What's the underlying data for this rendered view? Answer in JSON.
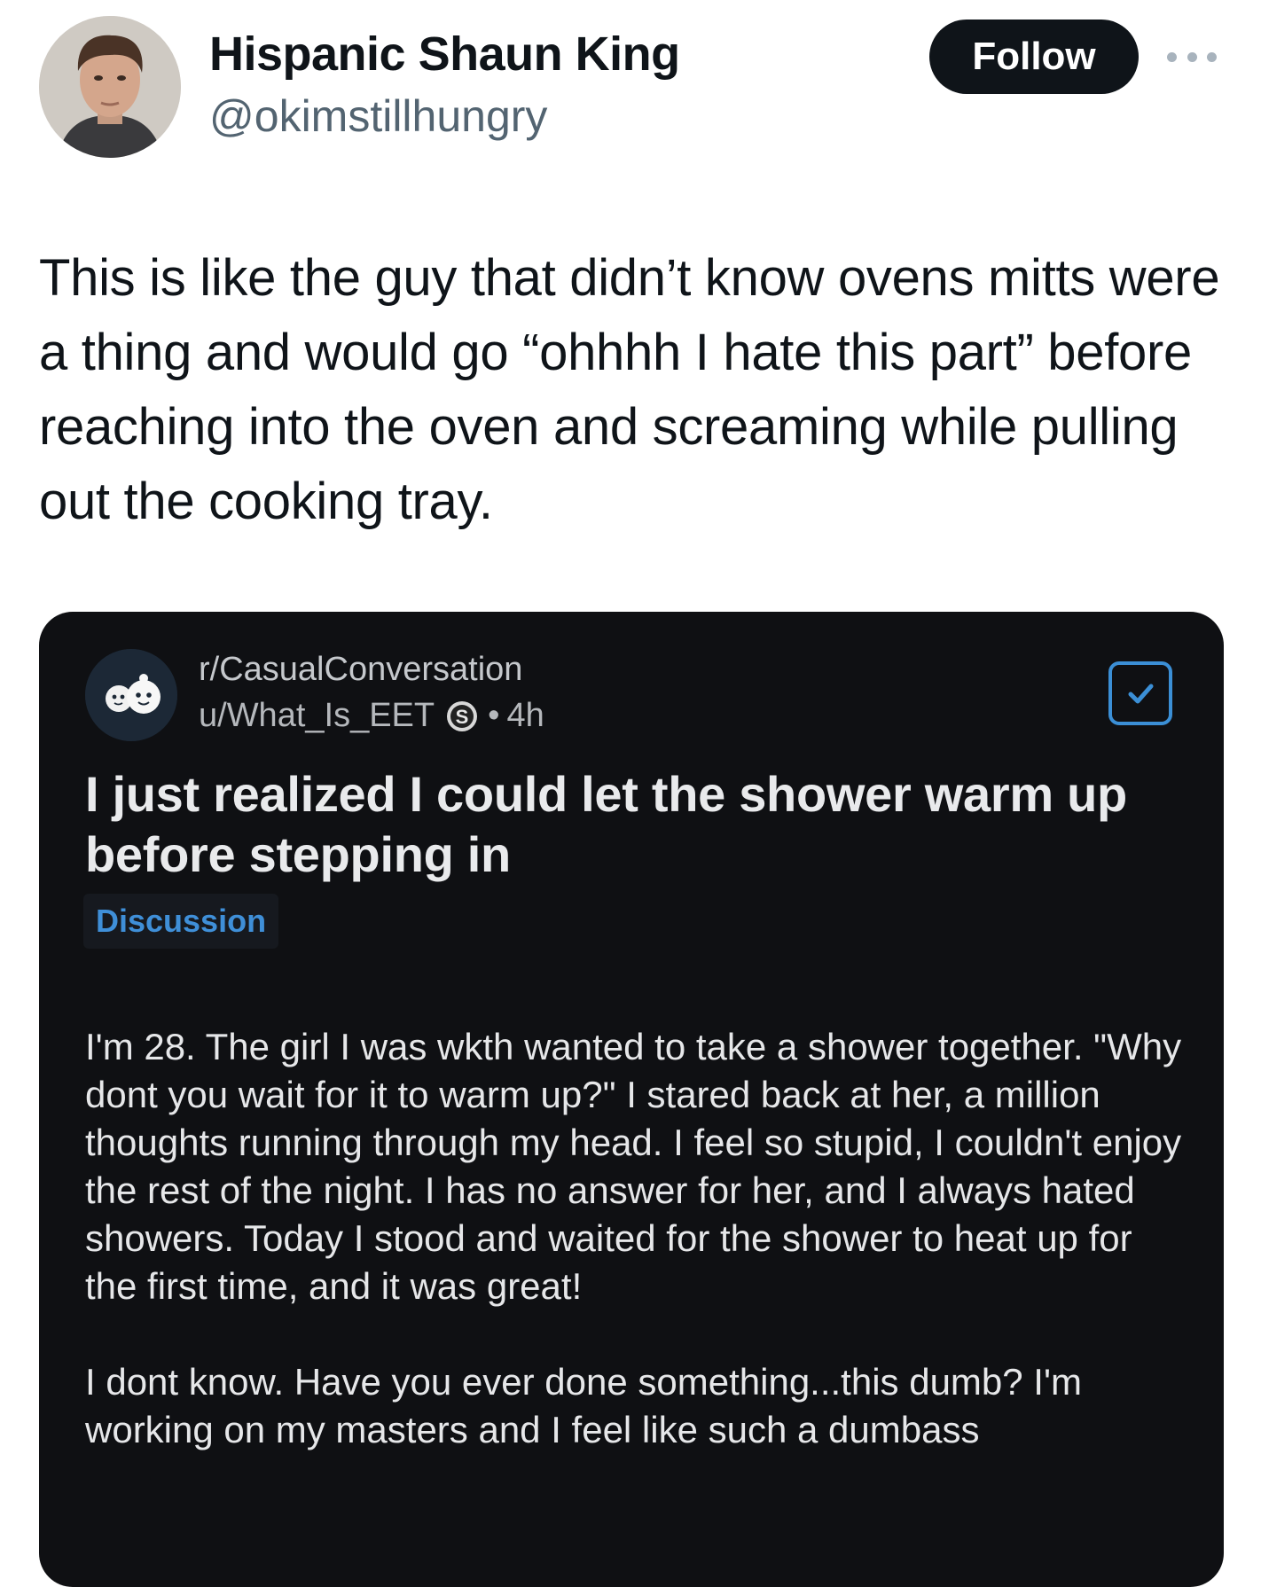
{
  "tweet": {
    "author_name": "Hispanic Shaun King",
    "author_handle": "@okimstillhungry",
    "follow_label": "Follow",
    "text": "This is like the guy that didn’t know ovens mitts were a thing and would go “ohhhh I hate this part” before reaching into the oven and screaming while pulling out the cooking tray."
  },
  "reddit_post": {
    "subreddit": "r/CasualConversation",
    "username": "u/What_Is_EET",
    "separator": "•",
    "age": "4h",
    "title": "I just realized I could let the shower warm up before stepping in",
    "flair": "Discussion",
    "body_paragraphs": [
      "I'm 28. The girl I was wkth wanted to take a shower together. \"Why dont you wait for it to warm up?\"  I stared back at her, a million thoughts running through my head. I feel so stupid, I couldn't enjoy the rest of the night. I has no answer for her, and I always hated showers. Today I stood and waited for the shower to heat up for the first time, and it was great!",
      "I dont know. Have you ever done something...this dumb? I'm working on my masters and I feel like such a dumbass"
    ]
  },
  "icons": {
    "more": "more-horizontal-icon",
    "badge": "snoo-badge-icon",
    "save": "checkmark-icon"
  },
  "colors": {
    "follow_bg": "#0f1419",
    "card_bg": "#0f1013",
    "flair_text": "#3f8fd8",
    "handle_gray": "#536471"
  }
}
